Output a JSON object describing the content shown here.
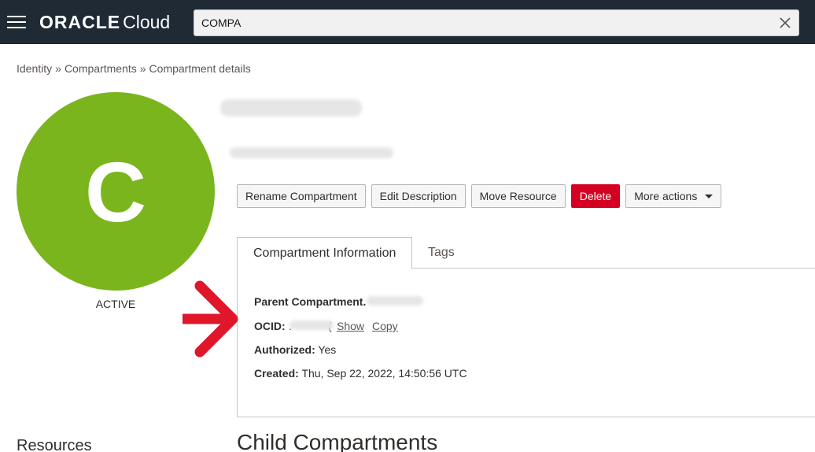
{
  "header": {
    "brand_oracle": "ORACLE",
    "brand_cloud": "Cloud",
    "search_value": "COMPA"
  },
  "breadcrumb": [
    "Identity",
    "Compartments",
    "Compartment details"
  ],
  "avatar": {
    "letter": "C",
    "color": "#7ab51d",
    "status": "ACTIVE"
  },
  "actions": {
    "rename": "Rename Compartment",
    "edit_description": "Edit Description",
    "move_resource": "Move Resource",
    "delete": "Delete",
    "more_actions": "More actions"
  },
  "tabs": {
    "info": "Compartment Information",
    "tags": "Tags"
  },
  "info": {
    "parent_label": "Parent Compartment.",
    "ocid_label": "OCID:",
    "ocid_prefix": ".",
    "ocid_suffix": "(",
    "show_link": "Show",
    "copy_link": "Copy",
    "authorized_label": "Authorized:",
    "authorized_value": "Yes",
    "created_label": "Created:",
    "created_value": "Thu, Sep 22, 2022, 14:50:56 UTC"
  },
  "sections": {
    "resources": "Resources",
    "child": "Child Compartments"
  },
  "colors": {
    "topbar": "#1f2a35",
    "delete": "#d40022",
    "arrow": "#e0162b"
  }
}
